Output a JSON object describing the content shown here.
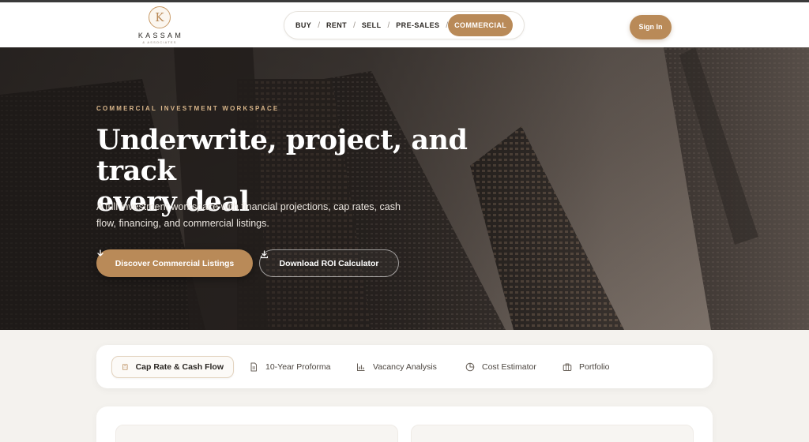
{
  "brand": {
    "name": "KASSAM",
    "sub": "& ASSOCIATES",
    "monogram": "K"
  },
  "nav": {
    "items": [
      {
        "label": "BUY"
      },
      {
        "label": "RENT"
      },
      {
        "label": "SELL"
      },
      {
        "label": "PRE-SALES"
      },
      {
        "label": "COMMERCIAL",
        "active": true
      }
    ],
    "separator": "/"
  },
  "header": {
    "signin_label": "Sign In"
  },
  "hero": {
    "eyebrow": "COMMERCIAL INVESTMENT WORKSPACE",
    "title_line1": "Underwrite, project, and track",
    "title_line2": "every deal",
    "description_line1": "A full investment workspace with financial projections, cap rates, cash",
    "description_line2": "flow, financing, and commercial listings.",
    "primary_button": "Discover Commercial Listings",
    "secondary_button": "Download ROI Calculator"
  },
  "tabs": [
    {
      "label": "Cap Rate & Cash Flow",
      "icon": "calculator-icon",
      "active": true
    },
    {
      "label": "10-Year Proforma",
      "icon": "document-icon"
    },
    {
      "label": "Vacancy Analysis",
      "icon": "bar-chart-icon"
    },
    {
      "label": "Cost Estimator",
      "icon": "pie-chart-icon"
    },
    {
      "label": "Portfolio",
      "icon": "briefcase-icon"
    }
  ],
  "colors": {
    "accent": "#b98a58",
    "background": "#f4f2ee",
    "text": "#2a2622"
  }
}
